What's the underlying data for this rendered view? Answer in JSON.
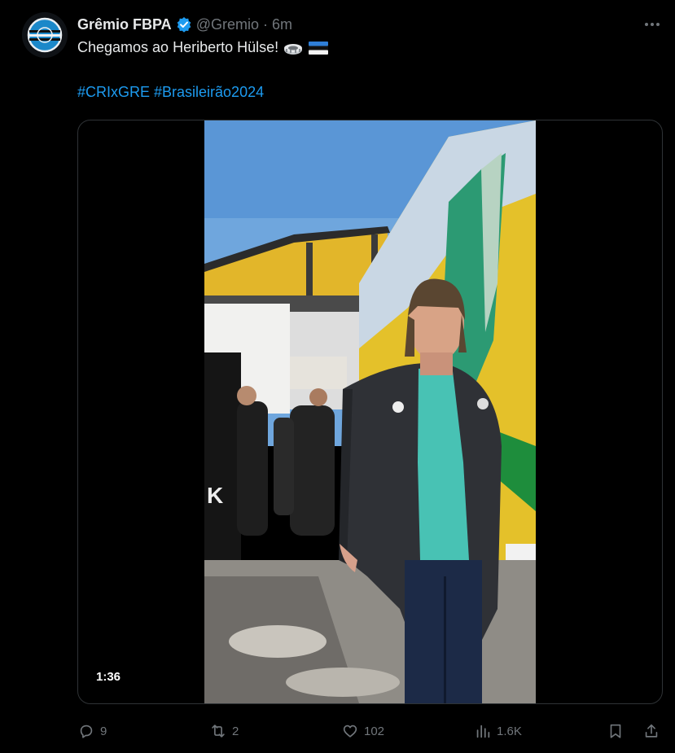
{
  "account": {
    "display_name": "Grêmio FBPA",
    "handle": "@Gremio",
    "separator": "·",
    "time": "6m",
    "verified": true,
    "avatar_icon": "gremio-crest-icon",
    "avatar_color": "#1b88c9"
  },
  "tweet": {
    "text": "Chegamos ao Heriberto Hülse!",
    "emojis": [
      "stadium-emoji",
      "estonia-flag-emoji"
    ],
    "hashtags": [
      "#CRIxGRE",
      "#Brasileirão2024"
    ]
  },
  "media": {
    "type": "video",
    "duration": "1:36"
  },
  "actions": {
    "replies": {
      "icon": "reply-icon",
      "count": "9"
    },
    "reposts": {
      "icon": "repost-icon",
      "count": "2"
    },
    "likes": {
      "icon": "like-icon",
      "count": "102"
    },
    "views": {
      "icon": "views-icon",
      "count": "1.6K"
    },
    "bookmark": {
      "icon": "bookmark-icon"
    },
    "share": {
      "icon": "share-icon"
    }
  },
  "colors": {
    "background": "#000000",
    "text": "#e7e9ea",
    "muted": "#71767b",
    "link": "#1d9bf0",
    "border": "#2f3336"
  }
}
